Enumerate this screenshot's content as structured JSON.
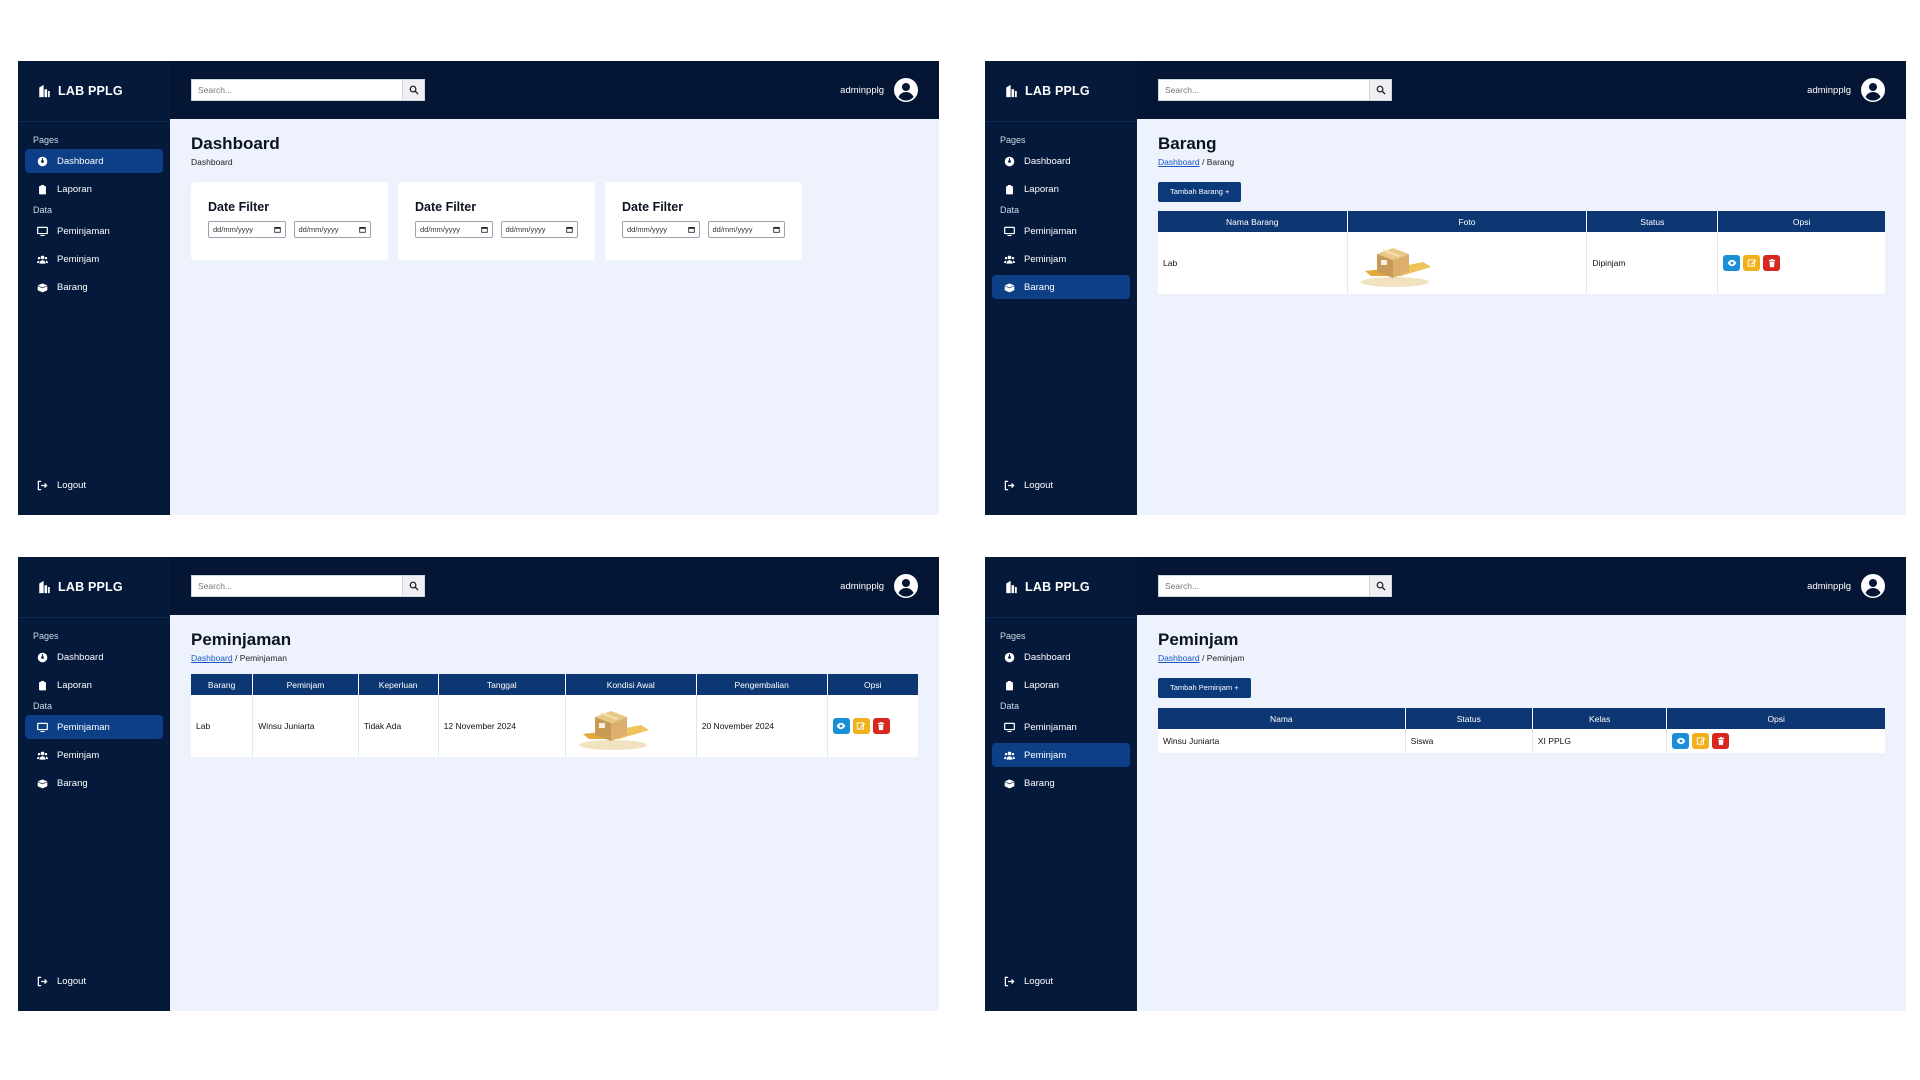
{
  "brand": {
    "name": "LAB PPLG"
  },
  "search": {
    "placeholder": "Search..."
  },
  "user": {
    "name": "adminpplg"
  },
  "nav": {
    "pages_label": "Pages",
    "data_label": "Data",
    "dashboard": "Dashboard",
    "laporan": "Laporan",
    "peminjaman": "Peminjaman",
    "peminjam": "Peminjam",
    "barang": "Barang",
    "logout": "Logout"
  },
  "colors": {
    "sidebar": "#051a3a",
    "topbar": "#041633",
    "active_nav": "#0d3f86",
    "table_header": "#0d3772",
    "view_btn": "#1a8fd6",
    "edit_btn": "#f1b11c",
    "delete_btn": "#d9271f"
  },
  "dashboard": {
    "title": "Dashboard",
    "crumb": "Dashboard",
    "cards": [
      {
        "title": "Date Filter",
        "from": "dd/mm/yyyy",
        "to": "dd/mm/yyyy"
      },
      {
        "title": "Date Filter",
        "from": "dd/mm/yyyy",
        "to": "dd/mm/yyyy"
      },
      {
        "title": "Date Filter",
        "from": "dd/mm/yyyy",
        "to": "dd/mm/yyyy"
      }
    ]
  },
  "barang": {
    "title": "Barang",
    "crumb_link": "Dashboard",
    "crumb_current": "/ Barang",
    "add_button": "Tambah Barang +",
    "columns": [
      "Nama Barang",
      "Foto",
      "Status",
      "Opsi"
    ],
    "rows": [
      {
        "nama": "Lab",
        "foto": "box-illustration",
        "status": "Dipinjam"
      }
    ]
  },
  "peminjaman": {
    "title": "Peminjaman",
    "crumb_link": "Dashboard",
    "crumb_current": "/ Peminjaman",
    "columns": [
      "Barang",
      "Peminjam",
      "Keperluan",
      "Tanggal",
      "Kondisi Awal",
      "Pengembalian",
      "Opsi"
    ],
    "rows": [
      {
        "barang": "Lab",
        "peminjam": "Winsu Juniarta",
        "keperluan": "Tidak Ada",
        "tanggal": "12 November 2024",
        "kondisi": "box-illustration",
        "pengembalian": "20 November 2024"
      }
    ]
  },
  "peminjam": {
    "title": "Peminjam",
    "crumb_link": "Dashboard",
    "crumb_current": "/ Peminjam",
    "add_button": "Tambah Peminjam +",
    "columns": [
      "Nama",
      "Status",
      "Kelas",
      "Opsi"
    ],
    "rows": [
      {
        "nama": "Winsu Juniarta",
        "status": "Siswa",
        "kelas": "XI PPLG"
      }
    ]
  }
}
